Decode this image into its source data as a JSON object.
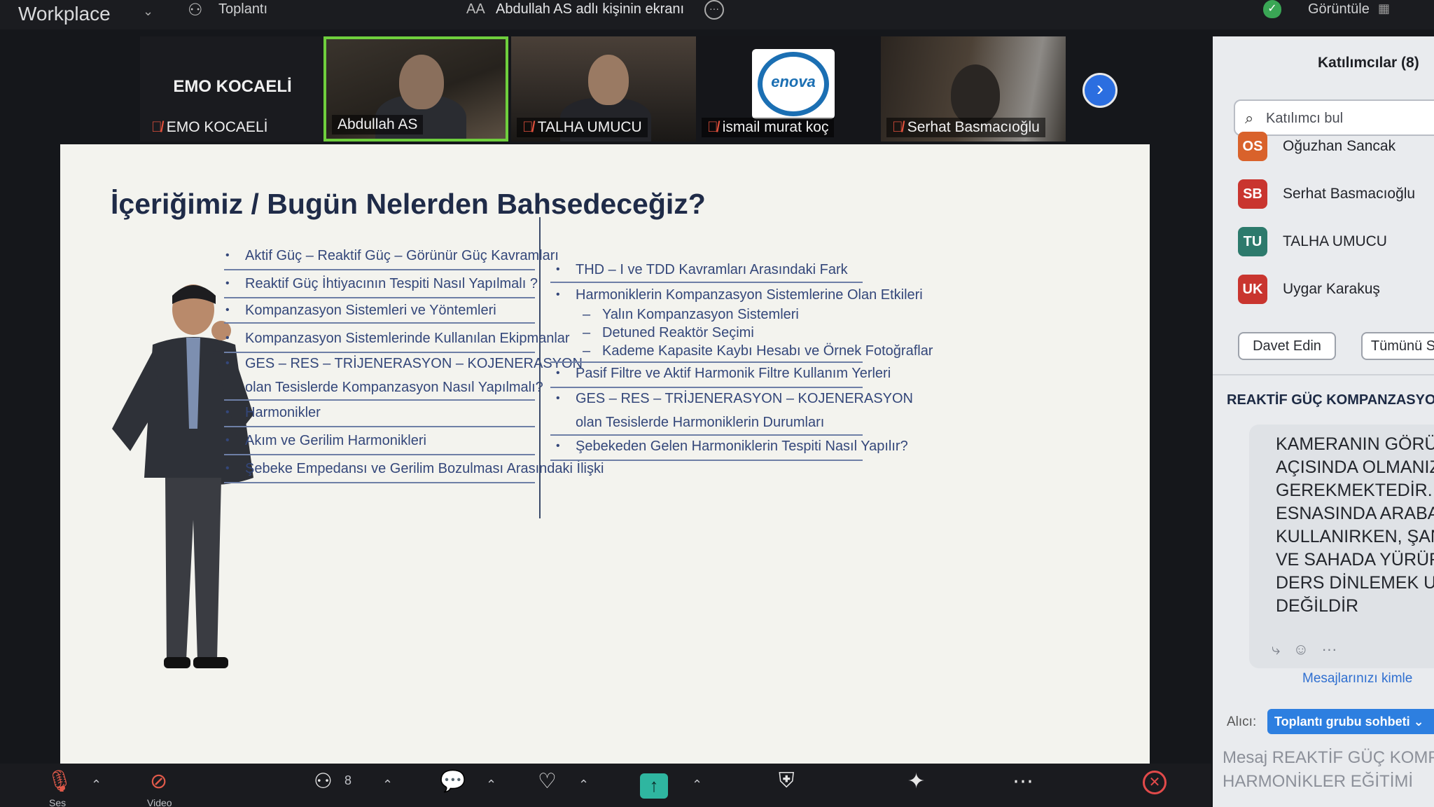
{
  "topbar": {
    "brand": "Workplace",
    "meeting_label": "Toplantı",
    "share_prefix": "AA",
    "share_label": "Abdullah AS adlı kişinin ekranı",
    "view_label": "Görüntüle"
  },
  "video_strip": {
    "tiles": [
      {
        "name": "EMO KOCAELİ",
        "big_label": "EMO KOCAELİ",
        "muted": true
      },
      {
        "name": "Abdullah AS",
        "muted": false,
        "active": true
      },
      {
        "name": "TALHA UMUCU",
        "muted": true
      },
      {
        "name": "ismail murat koç",
        "muted": true,
        "logo_text": "enova"
      },
      {
        "name": "Serhat Basmacıoğlu",
        "muted": true
      }
    ]
  },
  "slide": {
    "title": "İçeriğimiz / Bugün Nelerden Bahsedeceğiz?",
    "left_items": [
      "Aktif Güç – Reaktif Güç – Görünür Güç Kavramları",
      "Reaktif Güç İhtiyacının Tespiti Nasıl Yapılmalı ?",
      "Kompanzasyon Sistemleri ve Yöntemleri",
      "Kompanzasyon Sistemlerinde Kullanılan Ekipmanlar",
      "GES – RES – TRİJENERASYON – KOJENERASYON",
      "olan Tesislerde Kompanzasyon Nasıl Yapılmalı?",
      "Harmonikler",
      "Akım ve Gerilim Harmonikleri",
      "Şebeke Empedansı ve Gerilim Bozulması Arasındaki İlişki"
    ],
    "right_items": [
      "THD – I ve TDD Kavramları Arasındaki Fark",
      "Harmoniklerin Kompanzasyon Sistemlerine Olan Etkileri",
      "Yalın Kompanzasyon Sistemleri",
      "Detuned Reaktör Seçimi",
      "Kademe Kapasite Kaybı Hesabı ve Örnek Fotoğraflar",
      "Pasif Filtre ve Aktif Harmonik Filtre Kullanım Yerleri",
      "GES – RES – TRİJENERASYON – KOJENERASYON",
      "olan Tesislerde Harmoniklerin Durumları",
      "Şebekeden Gelen Harmoniklerin Tespiti Nasıl Yapılır?"
    ]
  },
  "panel": {
    "title": "Katılımcılar (8)",
    "search_placeholder": "Katılımcı bul",
    "participants": [
      {
        "initials": "OS",
        "name": "Oğuzhan Sancak",
        "color": "#d9622b"
      },
      {
        "initials": "SB",
        "name": "Serhat Basmacıoğlu",
        "color": "#c9352f"
      },
      {
        "initials": "TU",
        "name": "TALHA UMUCU",
        "color": "#2d7a6c"
      },
      {
        "initials": "UK",
        "name": "Uygar Karakuş",
        "color": "#c9352f"
      }
    ],
    "invite_label": "Davet Edin",
    "all_label": "Tümünü S",
    "chat_title": "REAKTİF GÜÇ KOMPANZASYO",
    "chat_lines": [
      "KAMERANIN GÖRÜŞ",
      "AÇISINDA OLMANIZ",
      "GEREKMEKTEDİR. DE",
      "ESNASINDA ARABA",
      "KULLANIRKEN, ŞANT",
      "VE SAHADA YÜRÜRK",
      "DERS DİNLEMEK UY",
      "DEĞİLDİR"
    ],
    "who_sees": "Mesajlarınızı kimle",
    "to_label": "Alıcı:",
    "to_value": "Toplantı grubu sohbeti ⌄",
    "message_lines": [
      "Mesaj REAKTİF GÜÇ KOMPA",
      "HARMONİKLER EĞİTİMİ"
    ]
  },
  "toolbar": {
    "audio_label": "Ses",
    "video_label": "Video",
    "participants_count": "8"
  }
}
